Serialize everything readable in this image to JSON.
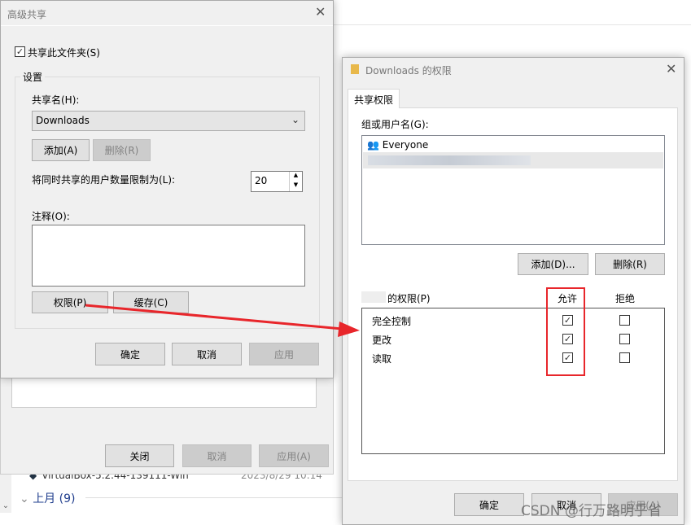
{
  "background": {
    "buttons": {
      "close": "关闭",
      "cancel": "取消",
      "apply": "应用(A)"
    },
    "file_row": {
      "name": "VirtualBox-5.2.44-139111-Win",
      "date": "2023/8/29 10:14"
    },
    "group": "上月 (9)"
  },
  "advanced": {
    "title": "高级共享",
    "share_checkbox": "共享此文件夹(S)",
    "share_checked": true,
    "settings_group": "设置",
    "share_name_label": "共享名(H):",
    "share_name_value": "Downloads",
    "add": "添加(A)",
    "remove": "删除(R)",
    "limit_label": "将同时共享的用户数量限制为(L):",
    "limit_value": "20",
    "comment_label": "注释(O):",
    "permissions": "权限(P)",
    "caching": "缓存(C)",
    "ok": "确定",
    "cancel": "取消",
    "apply": "应用"
  },
  "perm": {
    "title": "Downloads 的权限",
    "tab": "共享权限",
    "group_label": "组或用户名(G):",
    "users": [
      "Everyone"
    ],
    "add": "添加(D)...",
    "remove": "删除(R)",
    "perm_label": "的权限(P)",
    "allow": "允许",
    "deny": "拒绝",
    "rows": [
      {
        "name": "完全控制",
        "allow": true,
        "deny": false
      },
      {
        "name": "更改",
        "allow": true,
        "deny": false
      },
      {
        "name": "读取",
        "allow": true,
        "deny": false
      }
    ],
    "ok": "确定",
    "cancel": "取消",
    "apply": "应用(A)"
  },
  "watermark": "CSDN @行万路明乎省",
  "colors": {
    "highlight": "#e8262b"
  }
}
